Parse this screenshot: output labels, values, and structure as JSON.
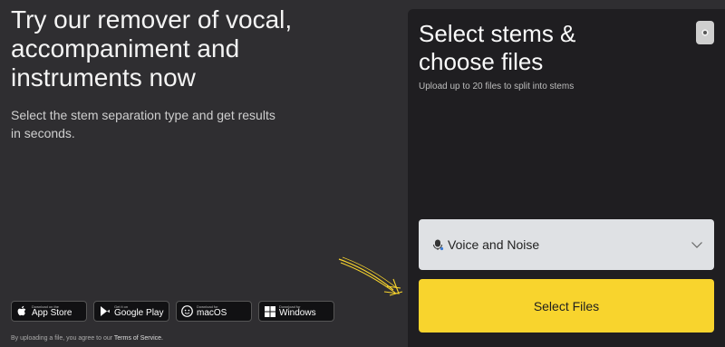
{
  "hero": {
    "title": "Try our remover of vocal, accompaniment and instruments now",
    "subtitle": "Select the stem separation type and get results in seconds."
  },
  "stores": [
    {
      "small": "Download on the",
      "big": "App Store",
      "icon": "apple-icon"
    },
    {
      "small": "Get it on",
      "big": "Google Play",
      "icon": "play-icon"
    },
    {
      "small": "Download for",
      "big": "macOS",
      "icon": "mac-icon"
    },
    {
      "small": "Download for",
      "big": "Windows",
      "icon": "windows-icon"
    }
  ],
  "terms": {
    "text": "By uploading a file, you agree to our ",
    "link": "Terms of Service."
  },
  "panel": {
    "title": "Select stems & choose files",
    "subtitle": "Upload up to 20 files to split into stems",
    "select_value": "Voice and Noise",
    "button": "Select Files"
  },
  "colors": {
    "background": "#2f2e31",
    "panel": "#1f1e21",
    "accent": "#f8d42d"
  }
}
